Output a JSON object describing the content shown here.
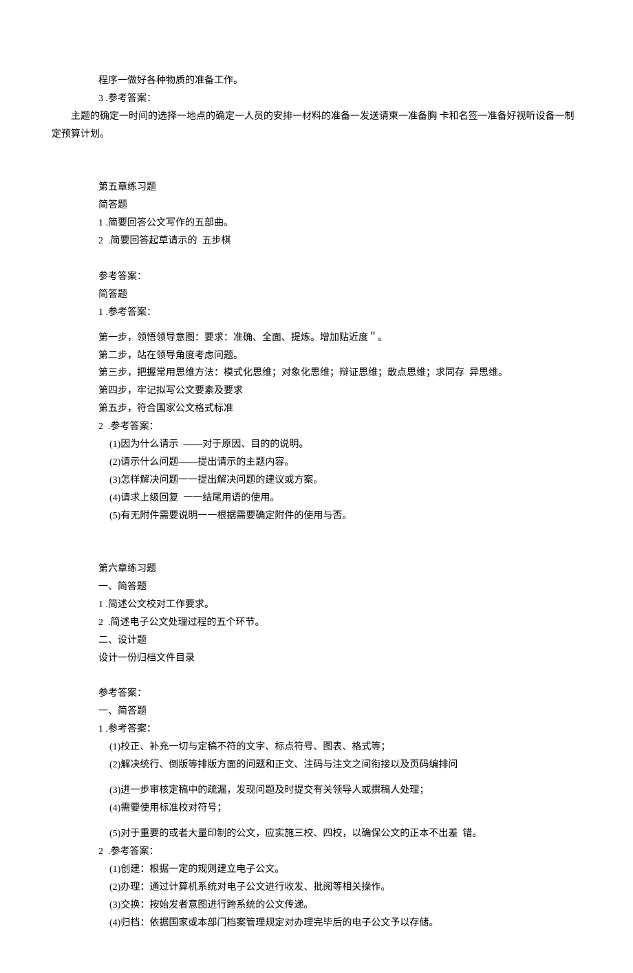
{
  "lines": [
    {
      "cls": "indent-1",
      "text": "程序一做好各种物质的准备工作。"
    },
    {
      "cls": "indent-1",
      "text": "3 .参考答案："
    },
    {
      "cls": "flush",
      "text": "        主题的确定一时间的选择一地点的确定一人员的安排一材料的准备一发送请柬一准备胸 卡和名签一准备好视听设备一制定预算计划。"
    },
    {
      "cls": "blank",
      "text": ""
    },
    {
      "cls": "blank",
      "text": ""
    },
    {
      "cls": "indent-1",
      "text": "第五章练习题"
    },
    {
      "cls": "indent-1",
      "text": "简答题"
    },
    {
      "cls": "indent-1",
      "text": "1 .简要回答公文写作的五部曲。"
    },
    {
      "cls": "indent-1",
      "text": "2  .简要回答起草请示的  五步棋"
    },
    {
      "cls": "blank",
      "text": ""
    },
    {
      "cls": "indent-1",
      "text": "参考答案："
    },
    {
      "cls": "indent-1",
      "text": "简答题"
    },
    {
      "cls": "indent-1",
      "text": "1 .参考答案："
    },
    {
      "cls": "blank-half",
      "text": ""
    },
    {
      "cls": "indent-1",
      "text": "第一步，领悟领导意图：要求：准确、全面、提炼。增加贴近度＂。"
    },
    {
      "cls": "indent-1",
      "text": "第二步，站在领导角度考虑问题。"
    },
    {
      "cls": "indent-1",
      "text": "第三步，把握常用思维方法：模式化思维；对象化思维；辩证思维；散点思维；求同存  异思维。"
    },
    {
      "cls": "indent-1",
      "text": "第四步，牢记拟写公文要素及要求"
    },
    {
      "cls": "indent-1",
      "text": "第五步，符合国家公文格式标准"
    },
    {
      "cls": "indent-1",
      "text": "2  .参考答案："
    },
    {
      "cls": "indent-2",
      "text": "(1)因为什么请示  ——对于原因、目的的说明。"
    },
    {
      "cls": "indent-2",
      "text": "(2)请示什么问题——提出请示的主题内容。"
    },
    {
      "cls": "indent-2",
      "text": "(3)怎样解决问题一一提出解决问题的建议或方案。"
    },
    {
      "cls": "indent-2",
      "text": "(4)请求上级回复  一一结尾用语的使用。"
    },
    {
      "cls": "indent-2",
      "text": "(5)有无附件需要说明一一根据需要确定附件的使用与否。"
    },
    {
      "cls": "blank",
      "text": ""
    },
    {
      "cls": "blank",
      "text": ""
    },
    {
      "cls": "indent-1",
      "text": "第六章练习题"
    },
    {
      "cls": "indent-1",
      "text": "一、简答题"
    },
    {
      "cls": "indent-1",
      "text": "1 .简述公文校对工作要求。"
    },
    {
      "cls": "indent-1",
      "text": "2  .简述电子公文处理过程的五个环节。"
    },
    {
      "cls": "indent-1",
      "text": "二、设计题"
    },
    {
      "cls": "indent-1",
      "text": "设计一份归档文件目录"
    },
    {
      "cls": "blank",
      "text": ""
    },
    {
      "cls": "indent-1",
      "text": "参考答案："
    },
    {
      "cls": "indent-1",
      "text": "一、简答题"
    },
    {
      "cls": "indent-1",
      "text": "1 .参考答案："
    },
    {
      "cls": "indent-2",
      "text": "(1)校正、补充一切与定稿不符的文字、标点符号、图表、格式等；"
    },
    {
      "cls": "indent-2",
      "text": "(2)解决统行、倒版等排版方面的问题和正文、注码与注文之间衔接以及页码编排问"
    },
    {
      "cls": "blank-half",
      "text": ""
    },
    {
      "cls": "indent-2",
      "text": "(3)进一步审核定稿中的疏漏，发现问题及时提交有关领导人或撰稿人处理；"
    },
    {
      "cls": "indent-2",
      "text": "(4)需要使用标准校对符号；"
    },
    {
      "cls": "blank-half",
      "text": ""
    },
    {
      "cls": "indent-2",
      "text": "(5)对于重要的或者大量印制的公文，应实施三校、四校，以确保公文的正本不出差  错。"
    },
    {
      "cls": "indent-1",
      "text": "2  .参考答案："
    },
    {
      "cls": "indent-2",
      "text": "(1)创建：根据一定的规则建立电子公文。"
    },
    {
      "cls": "indent-2",
      "text": "(2)办理：通过计算机系统对电子公文进行收发、批阅等相关操作。"
    },
    {
      "cls": "indent-2",
      "text": "(3)交换：按始发者意图进行跨系统的公文传递。"
    },
    {
      "cls": "indent-2",
      "text": "(4)归档：依据国家或本部门档案管理规定对办理完毕后的电子公文予以存储。"
    }
  ]
}
